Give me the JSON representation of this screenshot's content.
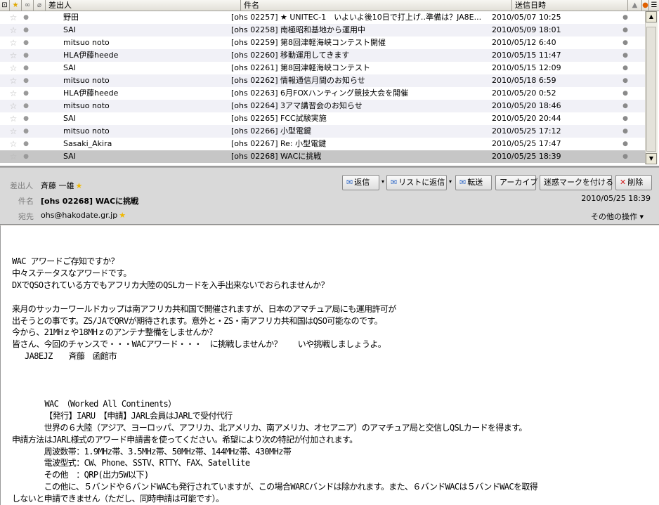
{
  "list": {
    "headers": {
      "from": "差出人",
      "subject": "件名",
      "date": "送信日時"
    },
    "rows": [
      {
        "from": "野田",
        "subject": "[ohs 02257] ★ UNITEC-1　いよいよ後10日で打上げ‥準備は？JA8E...",
        "date": "2010/05/07 10:25"
      },
      {
        "from": "SAI",
        "subject": "[ohs 02258] 南極昭和基地から運用中",
        "date": "2010/05/09 18:01"
      },
      {
        "from": "mitsuo noto",
        "subject": "[ohs 02259] 第8回津軽海峡コンテスト開催",
        "date": "2010/05/12 6:40"
      },
      {
        "from": "HLA伊藤heede",
        "subject": "[ohs 02260] 移動運用してきます",
        "date": "2010/05/15 11:47"
      },
      {
        "from": "SAI",
        "subject": "[ohs 02261] 第8回津軽海峡コンテスト",
        "date": "2010/05/15 12:09"
      },
      {
        "from": "mitsuo noto",
        "subject": "[ohs 02262] 情報通信月間のお知らせ",
        "date": "2010/05/18 6:59"
      },
      {
        "from": "HLA伊藤heede",
        "subject": "[ohs 02263] 6月FOXハンティング競技大会を開催",
        "date": "2010/05/20 0:52"
      },
      {
        "from": "mitsuo noto",
        "subject": "[ohs 02264] 3アマ講習会のお知らせ",
        "date": "2010/05/20 18:46"
      },
      {
        "from": "SAI",
        "subject": "[ohs 02265] FCC試験実施",
        "date": "2010/05/20 20:44"
      },
      {
        "from": "mitsuo noto",
        "subject": "[ohs 02266] 小型電鍵",
        "date": "2010/05/25 17:12"
      },
      {
        "from": "Sasaki_Akira",
        "subject": "[ohs 02267] Re: 小型電鍵",
        "date": "2010/05/25 17:47"
      },
      {
        "from": "SAI",
        "subject": "[ohs 02268] WACに挑戦",
        "date": "2010/05/25 18:39"
      }
    ]
  },
  "header": {
    "from_label": "差出人",
    "from_value": "斉藤 一雄",
    "subject_label": "件名",
    "subject_value": "[ohs 02268] WACに挑戦",
    "to_label": "宛先",
    "to_value": "ohs@hakodate.gr.jp",
    "date": "2010/05/25 18:39",
    "more_actions": "その他の操作 ▾"
  },
  "toolbar": {
    "reply": "返信",
    "reply_list": "リストに返信",
    "forward": "転送",
    "archive": "アーカイブ",
    "junk": "迷惑マークを付ける",
    "delete": "削除"
  },
  "body": "WAC アワードご存知ですか？\n中々ステータスなアワードです。\nDXでQSOされている方でもアフリカ大陸のQSLカードを入手出来ないでおられませんか？\n\n来月のサッカーワールドカップは南アフリカ共和国で開催されますが、日本のアマチュア局にも運用許可が\n出そうとの事です。ZS/JAでQRVが期待されます。意外と・ZS・南アフリカ共和国はQSO可能なのです。\n今から、21MHｚや18MHｚのアンテナ整備をしませんか？\n皆さん、今回のチャンスで・・・WACアワード・・・　に挑戦しませんか？　　いや挑戦しましょうよ。\n　 JA8EJZ　　斉藤　函館市\n\n\n\n       WAC　（Worked All Continents）\n       【発行】IARU　【申請】JARL会員はJARLで受付代行\n　　　　世界の６大陸（アジア、ヨーロッパ、アフリカ、北アメリカ、南アメリカ、オセアニア）のアマチュア局と交信しQSLカードを得ます。\n申請方法はJARL様式のアワード申請書を使ってください。希望により次の特記が付加されます。\n　　　　周波数帯：1.9MHz帯、3.5MHz帯、50MHz帯、144MHz帯、430MHz帯\n　　　　電波型式：CW、Phone、SSTV、RTTY、FAX、Satellite\n　　　　その他　：QRP(出力5W以下)\n　　　　この他に、５バンドや６バンドWACも発行されていますが、この場合WARCバンドは除かれます。また、６バンドWACは５バンドWACを取得\nしないと申請できません（ただし、同時申請は可能です）。"
}
